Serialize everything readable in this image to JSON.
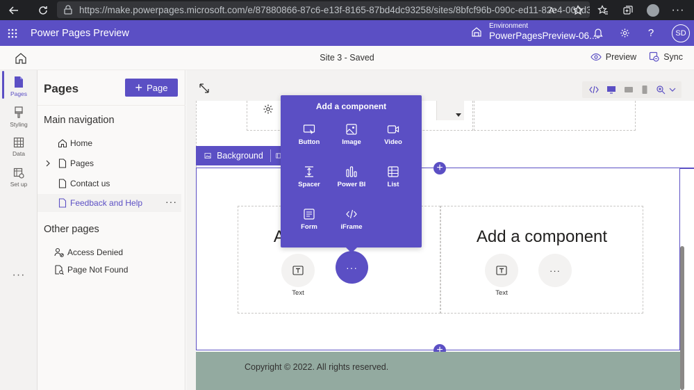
{
  "browser": {
    "url": "https://make.powerpages.microsoft.com/e/87880866-87c6-e13f-8165-87bd4dc93258/sites/8bfcf96b-090c-ed11-82e4-000d3adb21ea#we..."
  },
  "app": {
    "title": "Power Pages Preview",
    "environment_label": "Environment",
    "environment_name": "PowerPagesPreview-06...",
    "user_initials": "SD"
  },
  "command_bar": {
    "site_status": "Site 3 - Saved",
    "preview_label": "Preview",
    "sync_label": "Sync"
  },
  "rail": {
    "items": [
      {
        "label": "Pages"
      },
      {
        "label": "Styling"
      },
      {
        "label": "Data"
      },
      {
        "label": "Set up"
      }
    ],
    "more": "···"
  },
  "pages_panel": {
    "title": "Pages",
    "add_label": "Page",
    "main_nav_heading": "Main navigation",
    "main_nav": [
      {
        "label": "Home"
      },
      {
        "label": "Pages"
      },
      {
        "label": "Contact us"
      },
      {
        "label": "Feedback and Help"
      }
    ],
    "other_heading": "Other pages",
    "other": [
      {
        "label": "Access Denied"
      },
      {
        "label": "Page Not Found"
      }
    ]
  },
  "canvas": {
    "section_toolbar_label": "Background",
    "columns": [
      {
        "title": "Add a component",
        "text_label": "Text"
      },
      {
        "title": "Add a component",
        "text_label": "Text"
      }
    ],
    "footer_text": "Copyright © 2022. All rights reserved."
  },
  "popup": {
    "title": "Add a component",
    "items": [
      {
        "label": "Button",
        "icon": "button-icon"
      },
      {
        "label": "Image",
        "icon": "image-icon"
      },
      {
        "label": "Video",
        "icon": "video-icon"
      },
      {
        "label": "Spacer",
        "icon": "spacer-icon"
      },
      {
        "label": "Power BI",
        "icon": "power-bi-icon"
      },
      {
        "label": "List",
        "icon": "list-icon"
      },
      {
        "label": "Form",
        "icon": "form-icon"
      },
      {
        "label": "iFrame",
        "icon": "iframe-icon"
      }
    ]
  },
  "colors": {
    "brand": "#5b4fc4",
    "footer": "#93aaa0",
    "browser_chrome": "#202124"
  }
}
